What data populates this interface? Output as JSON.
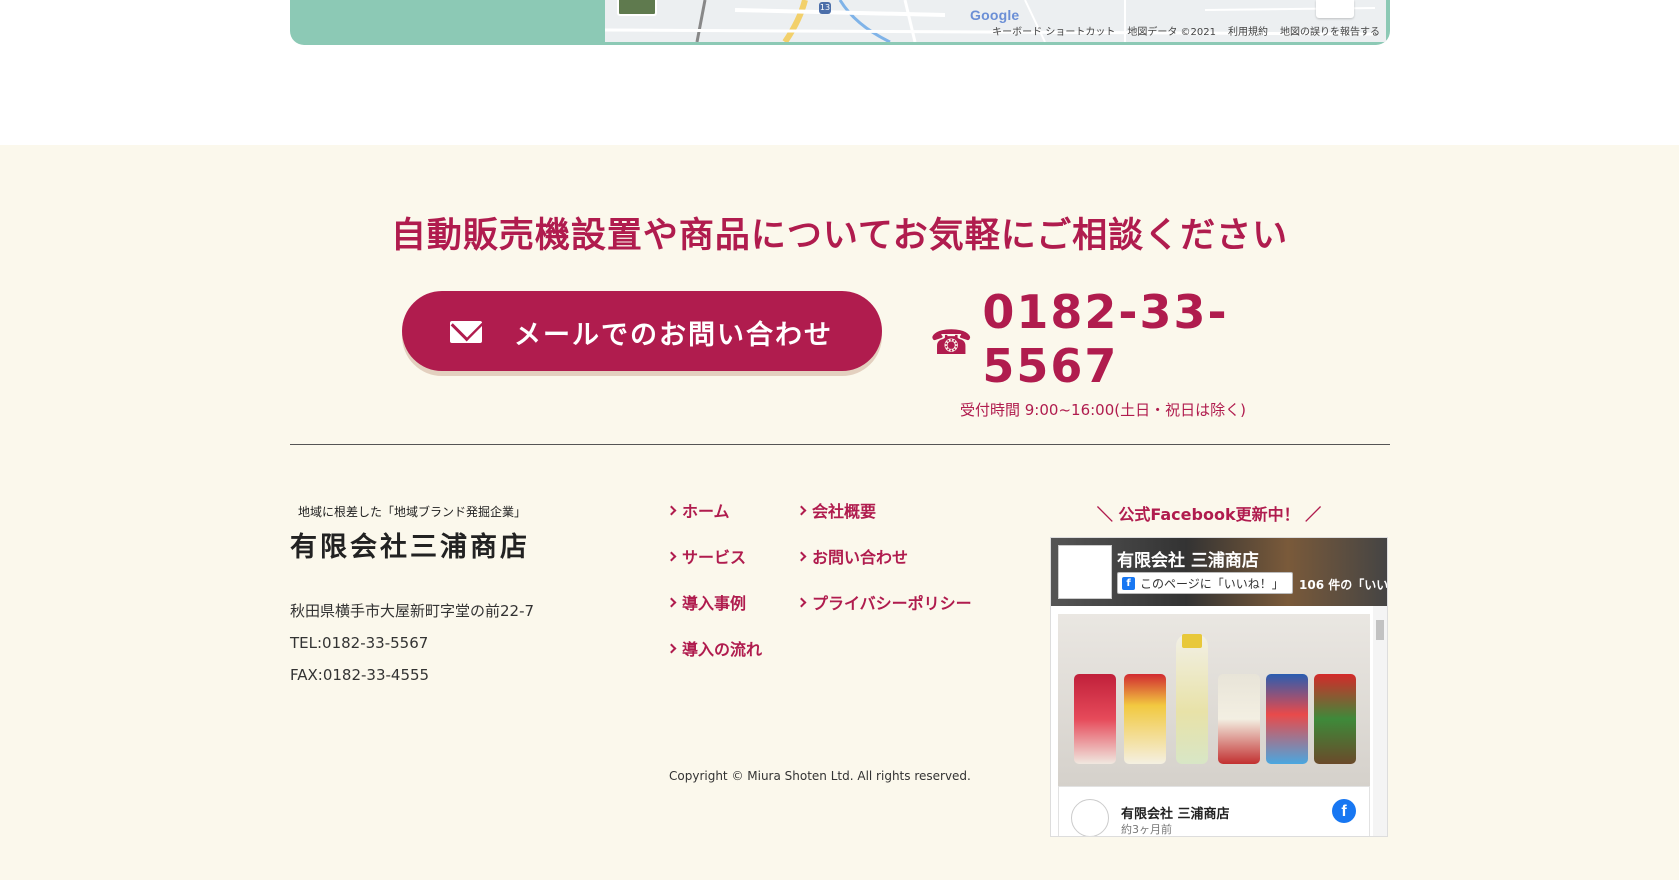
{
  "map": {
    "logo": "Google",
    "route_number": "13",
    "attribution": [
      "キーボード ショートカット",
      "地図データ ©2021",
      "利用規約",
      "地図の誤りを報告する"
    ]
  },
  "cta": {
    "title": "自動販売機設置や商品についてお気軽にご相談ください",
    "mail_button_label": "メールでのお問い合わせ",
    "phone_icon": "☎",
    "phone_number": "0182-33-5567",
    "phone_hours": "受付時間 9:00~16:00(土日・祝日は除く)"
  },
  "company": {
    "tagline": "地域に根差した「地域ブランド発掘企業」",
    "name": "有限会社三浦商店",
    "address": "秋田県横手市大屋新町字堂の前22-7",
    "tel": "TEL:0182-33-5567",
    "fax": "FAX:0182-33-4555"
  },
  "nav": {
    "items": [
      {
        "label": "ホーム"
      },
      {
        "label": "会社概要"
      },
      {
        "label": "サービス"
      },
      {
        "label": "お問い合わせ"
      },
      {
        "label": "導入事例"
      },
      {
        "label": "プライバシーポリシー"
      },
      {
        "label": "導入の流れ"
      }
    ]
  },
  "copyright": "Copyright © Miura Shoten Ltd. All rights reserved.",
  "facebook": {
    "heading": "＼ 公式Facebook更新中！ ／",
    "page_name": "有限会社 三浦商店",
    "like_label": "このページに「いいね！」",
    "likes_count": "106 件の「いい",
    "post_author": "有限会社 三浦商店",
    "post_time": "約3ヶ月前",
    "icon": "f"
  },
  "colors": {
    "accent": "#b01c4e",
    "footer_bg": "#fbf8ec",
    "map_green": "#8cc9b5"
  }
}
